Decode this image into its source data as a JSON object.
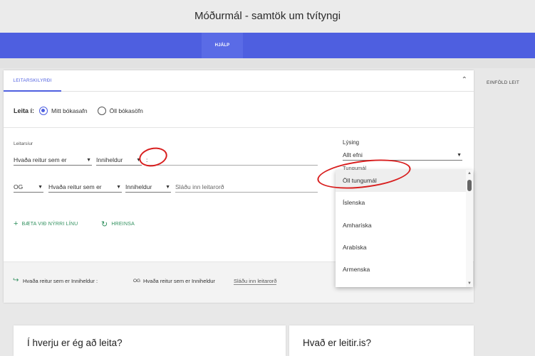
{
  "header": {
    "title": "Móðurmál - samtök um tvítyngi"
  },
  "nav": {
    "help": "HJÁLP"
  },
  "panel": {
    "tab": "LEITARSKILYRÐI",
    "search_in_label": "Leita í:",
    "radio_my_library": "Mitt bókasafn",
    "radio_all_libraries": "Öll bókasöfn",
    "filters_label": "Leitarsíur",
    "row1": {
      "field": "Hvaða reitur sem er",
      "operator": "Inniheldur",
      "value": ":"
    },
    "row2": {
      "bool": "OG",
      "field": "Hvaða reitur sem er",
      "operator": "Inniheldur",
      "placeholder": "Sláðu inn leitarorð"
    },
    "add_line": "BÆTA VIÐ NÝRRI LÍNU",
    "reset": "HREINSA",
    "description_label": "Lýsing",
    "description_value": "Allt efni",
    "language_label": "Tungumál",
    "summary": {
      "part1": "Hvaða reitur sem er Inniheldur :",
      "og": "OG",
      "part2": "Hvaða reitur sem er Inniheldur",
      "placeholder": "Sláðu inn leitarorð"
    }
  },
  "language_dropdown": {
    "options": [
      "Öll tungumál",
      "Íslenska",
      "Amharíska",
      "Arabíska",
      "Armenska"
    ],
    "selected": "Öll tungumál"
  },
  "simple_search": "EINFÖLD LEIT",
  "cards": {
    "left_title": "Í hverju er ég að leita?",
    "right_title": "Hvað er leitir.is?"
  },
  "colors": {
    "accent": "#4e5fe0",
    "green": "#2f8f5d",
    "annotation": "#d81e1e"
  }
}
